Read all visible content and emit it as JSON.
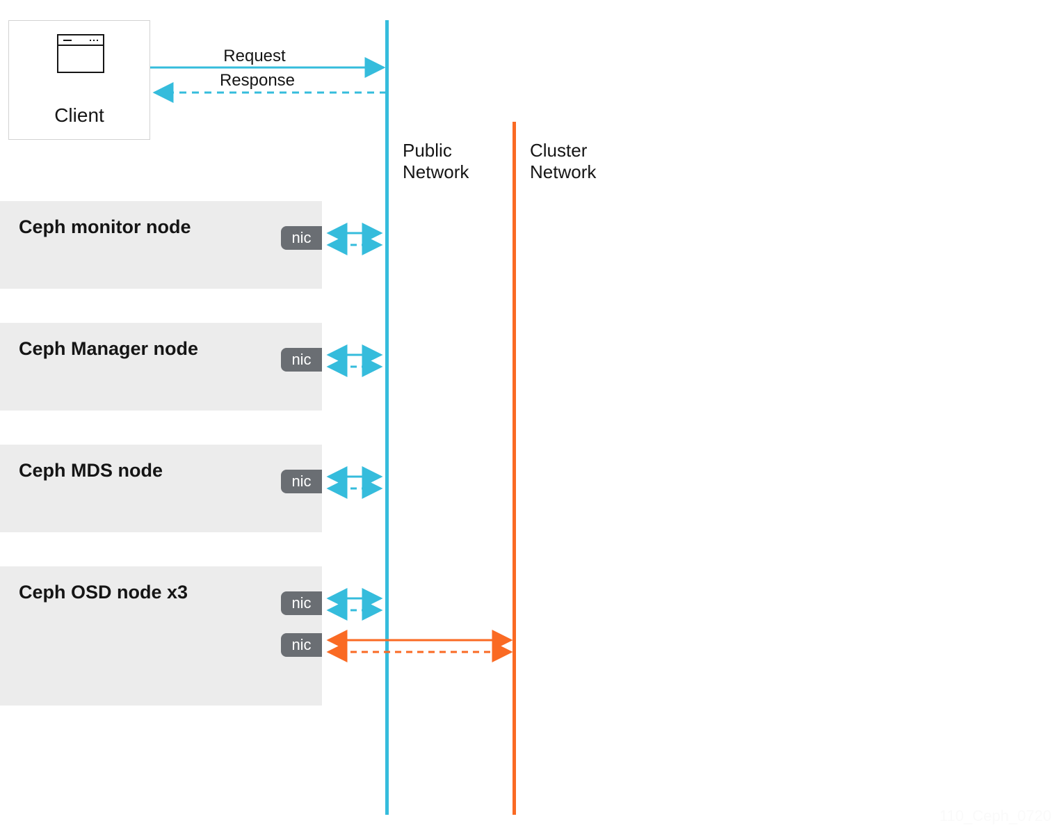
{
  "colors": {
    "blue": "#35bcdc",
    "orange": "#fa6a23",
    "gray": "#6a6e73",
    "panel": "#ececec"
  },
  "client": {
    "label": "Client"
  },
  "flows": {
    "request": "Request",
    "response": "Response"
  },
  "networks": {
    "public": "Public\nNetwork",
    "cluster": "Cluster\nNetwork"
  },
  "nodes": [
    {
      "title": "Ceph monitor node",
      "nics": 1,
      "cluster_nic": false
    },
    {
      "title": "Ceph Manager node",
      "nics": 1,
      "cluster_nic": false
    },
    {
      "title": "Ceph MDS node",
      "nics": 1,
      "cluster_nic": false
    },
    {
      "title": "Ceph OSD node x3",
      "nics": 2,
      "cluster_nic": true
    }
  ],
  "nic_label": "nic",
  "watermark": "110_Ceph_0720"
}
